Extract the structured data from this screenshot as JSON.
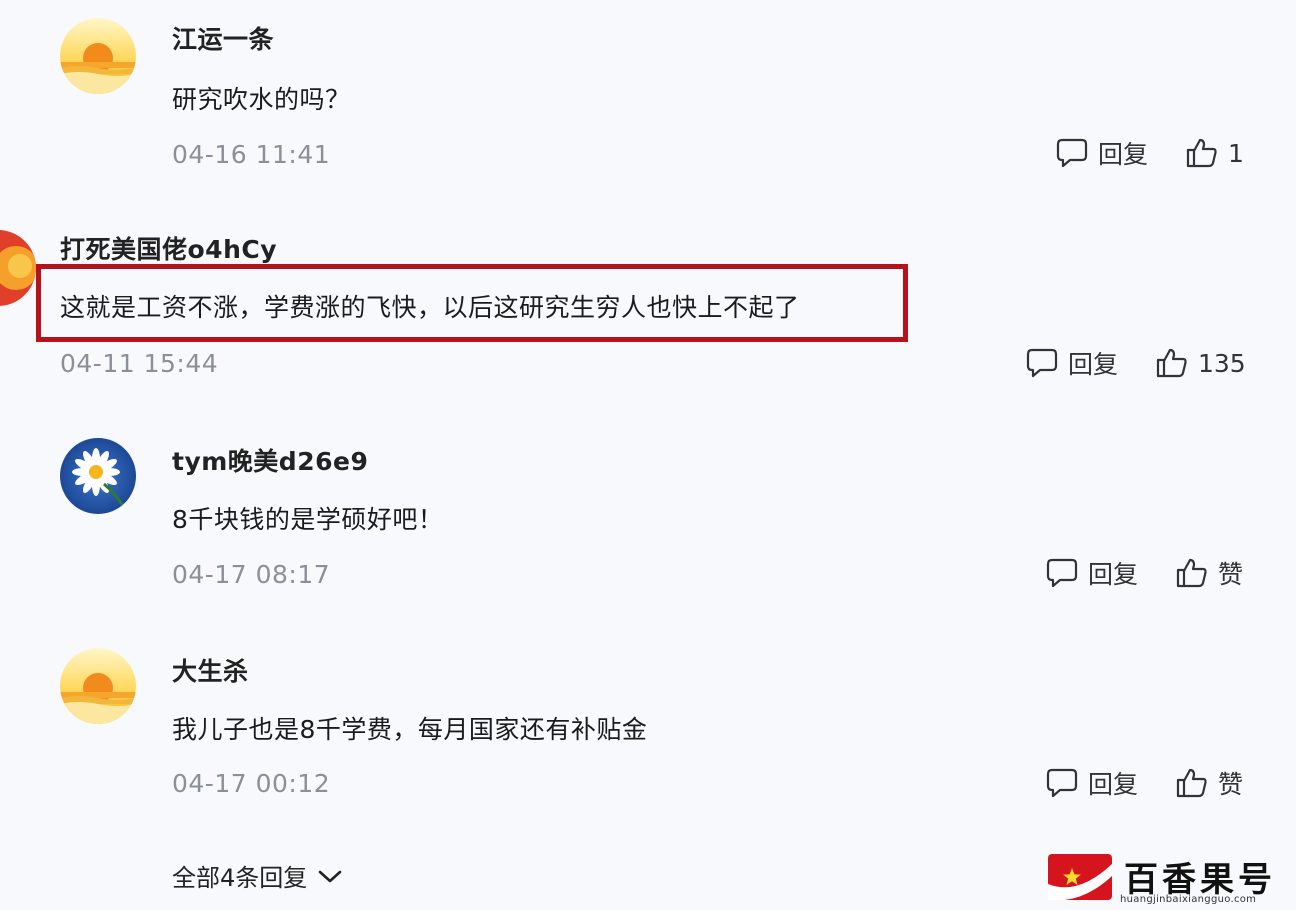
{
  "comments": [
    {
      "username": "江运一条",
      "text": "研究吹水的吗？",
      "time": "04-16 11:41",
      "reply_label": "回复",
      "like_label": "1",
      "avatar": "sunset-avatar"
    },
    {
      "username": "打死美国佬o4hCy",
      "text": "这就是工资不涨，学费涨的飞快，以后这研究生穷人也快上不起了",
      "time": "04-11 15:44",
      "reply_label": "回复",
      "like_label": "135",
      "avatar": "red-avatar",
      "highlighted": true
    },
    {
      "username": "tym晚美d26e9",
      "text": "8千块钱的是学硕好吧！",
      "time": "04-17 08:17",
      "reply_label": "回复",
      "like_label": "赞",
      "avatar": "daisy-avatar"
    },
    {
      "username": "大生杀",
      "text": "我儿子也是8千学费，每月国家还有补贴金",
      "time": "04-17 00:12",
      "reply_label": "回复",
      "like_label": "赞",
      "avatar": "sunset-avatar"
    }
  ],
  "show_all_label": "全部4条回复",
  "watermark": {
    "title": "百香果号",
    "url": "huangjinbaixiangguo.com"
  },
  "colors": {
    "highlight_border": "#b5121b",
    "timestamp": "#8a8f99",
    "background": "#f8f9fc",
    "watermark_red": "#d6141e"
  },
  "icons": {
    "reply": "comment-bubble-icon",
    "like": "thumbs-up-icon",
    "expand": "chevron-down-icon"
  }
}
